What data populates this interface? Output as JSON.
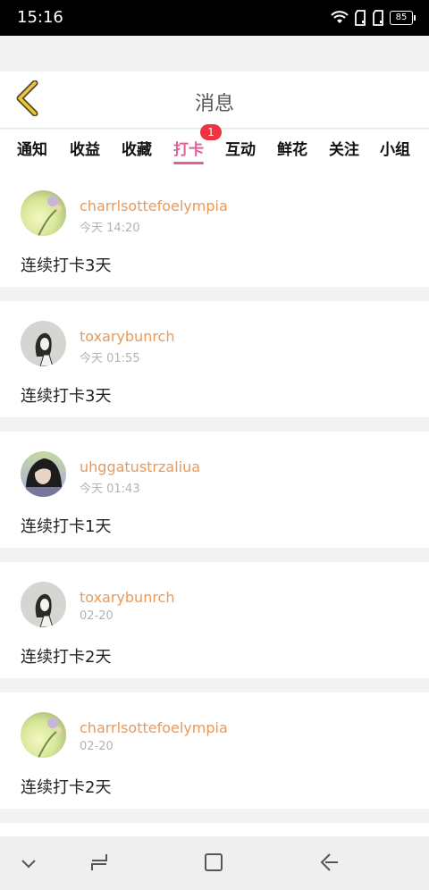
{
  "status_bar": {
    "time": "15:16",
    "battery": "85"
  },
  "header": {
    "title": "消息"
  },
  "tabs": [
    {
      "label": "通知"
    },
    {
      "label": "收益"
    },
    {
      "label": "收藏"
    },
    {
      "label": "打卡",
      "active": true,
      "badge": "1"
    },
    {
      "label": "互动"
    },
    {
      "label": "鲜花"
    },
    {
      "label": "关注"
    },
    {
      "label": "小组"
    }
  ],
  "feed": [
    {
      "username": "charrlsottefoelympia",
      "time": "今天 14:20",
      "message": "连续打卡3天",
      "avatar": "flower-avatar"
    },
    {
      "username": "toxarybunrch",
      "time": "今天 01:55",
      "message": "连续打卡3天",
      "avatar": "sketch-girl-avatar"
    },
    {
      "username": "uhggatustrzaliua",
      "time": "今天 01:43",
      "message": "连续打卡1天",
      "avatar": "photo-girl-avatar"
    },
    {
      "username": "toxarybunrch",
      "time": "02-20",
      "message": "连续打卡2天",
      "avatar": "sketch-girl-avatar"
    },
    {
      "username": "charrlsottefoelympia",
      "time": "02-20",
      "message": "连续打卡2天",
      "avatar": "flower-avatar"
    }
  ],
  "colors": {
    "accent": "#e0609a",
    "badge": "#ef3340",
    "username": "#e89a5a",
    "back_arrow": "#e8c63a"
  },
  "nav_bar": {
    "icons": [
      "chevron-down-icon",
      "recent-apps-icon",
      "home-icon",
      "back-icon"
    ]
  }
}
